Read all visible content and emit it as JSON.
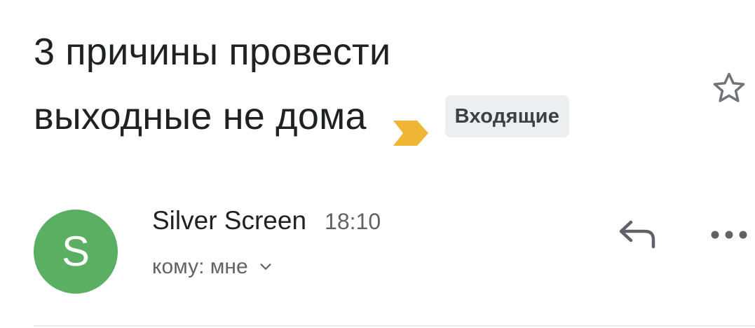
{
  "subject": {
    "line1": "3 причины провести",
    "line2": "выходные не дома",
    "label": "Входящие",
    "importance_marker_color": "#EFB534"
  },
  "star": {
    "icon": "star-outline-icon",
    "state": "unstarred"
  },
  "sender": {
    "avatar_letter": "S",
    "avatar_color": "#5BAF62",
    "name": "Silver Screen",
    "time": "18:10",
    "recipient_text": "кому: мне"
  },
  "actions": {
    "reply_icon": "reply-icon",
    "more_icon": "more-horizontal-icon"
  },
  "colors": {
    "text_primary": "#202124",
    "text_secondary": "#5F6368",
    "chip_bg": "#ECEEF0"
  }
}
